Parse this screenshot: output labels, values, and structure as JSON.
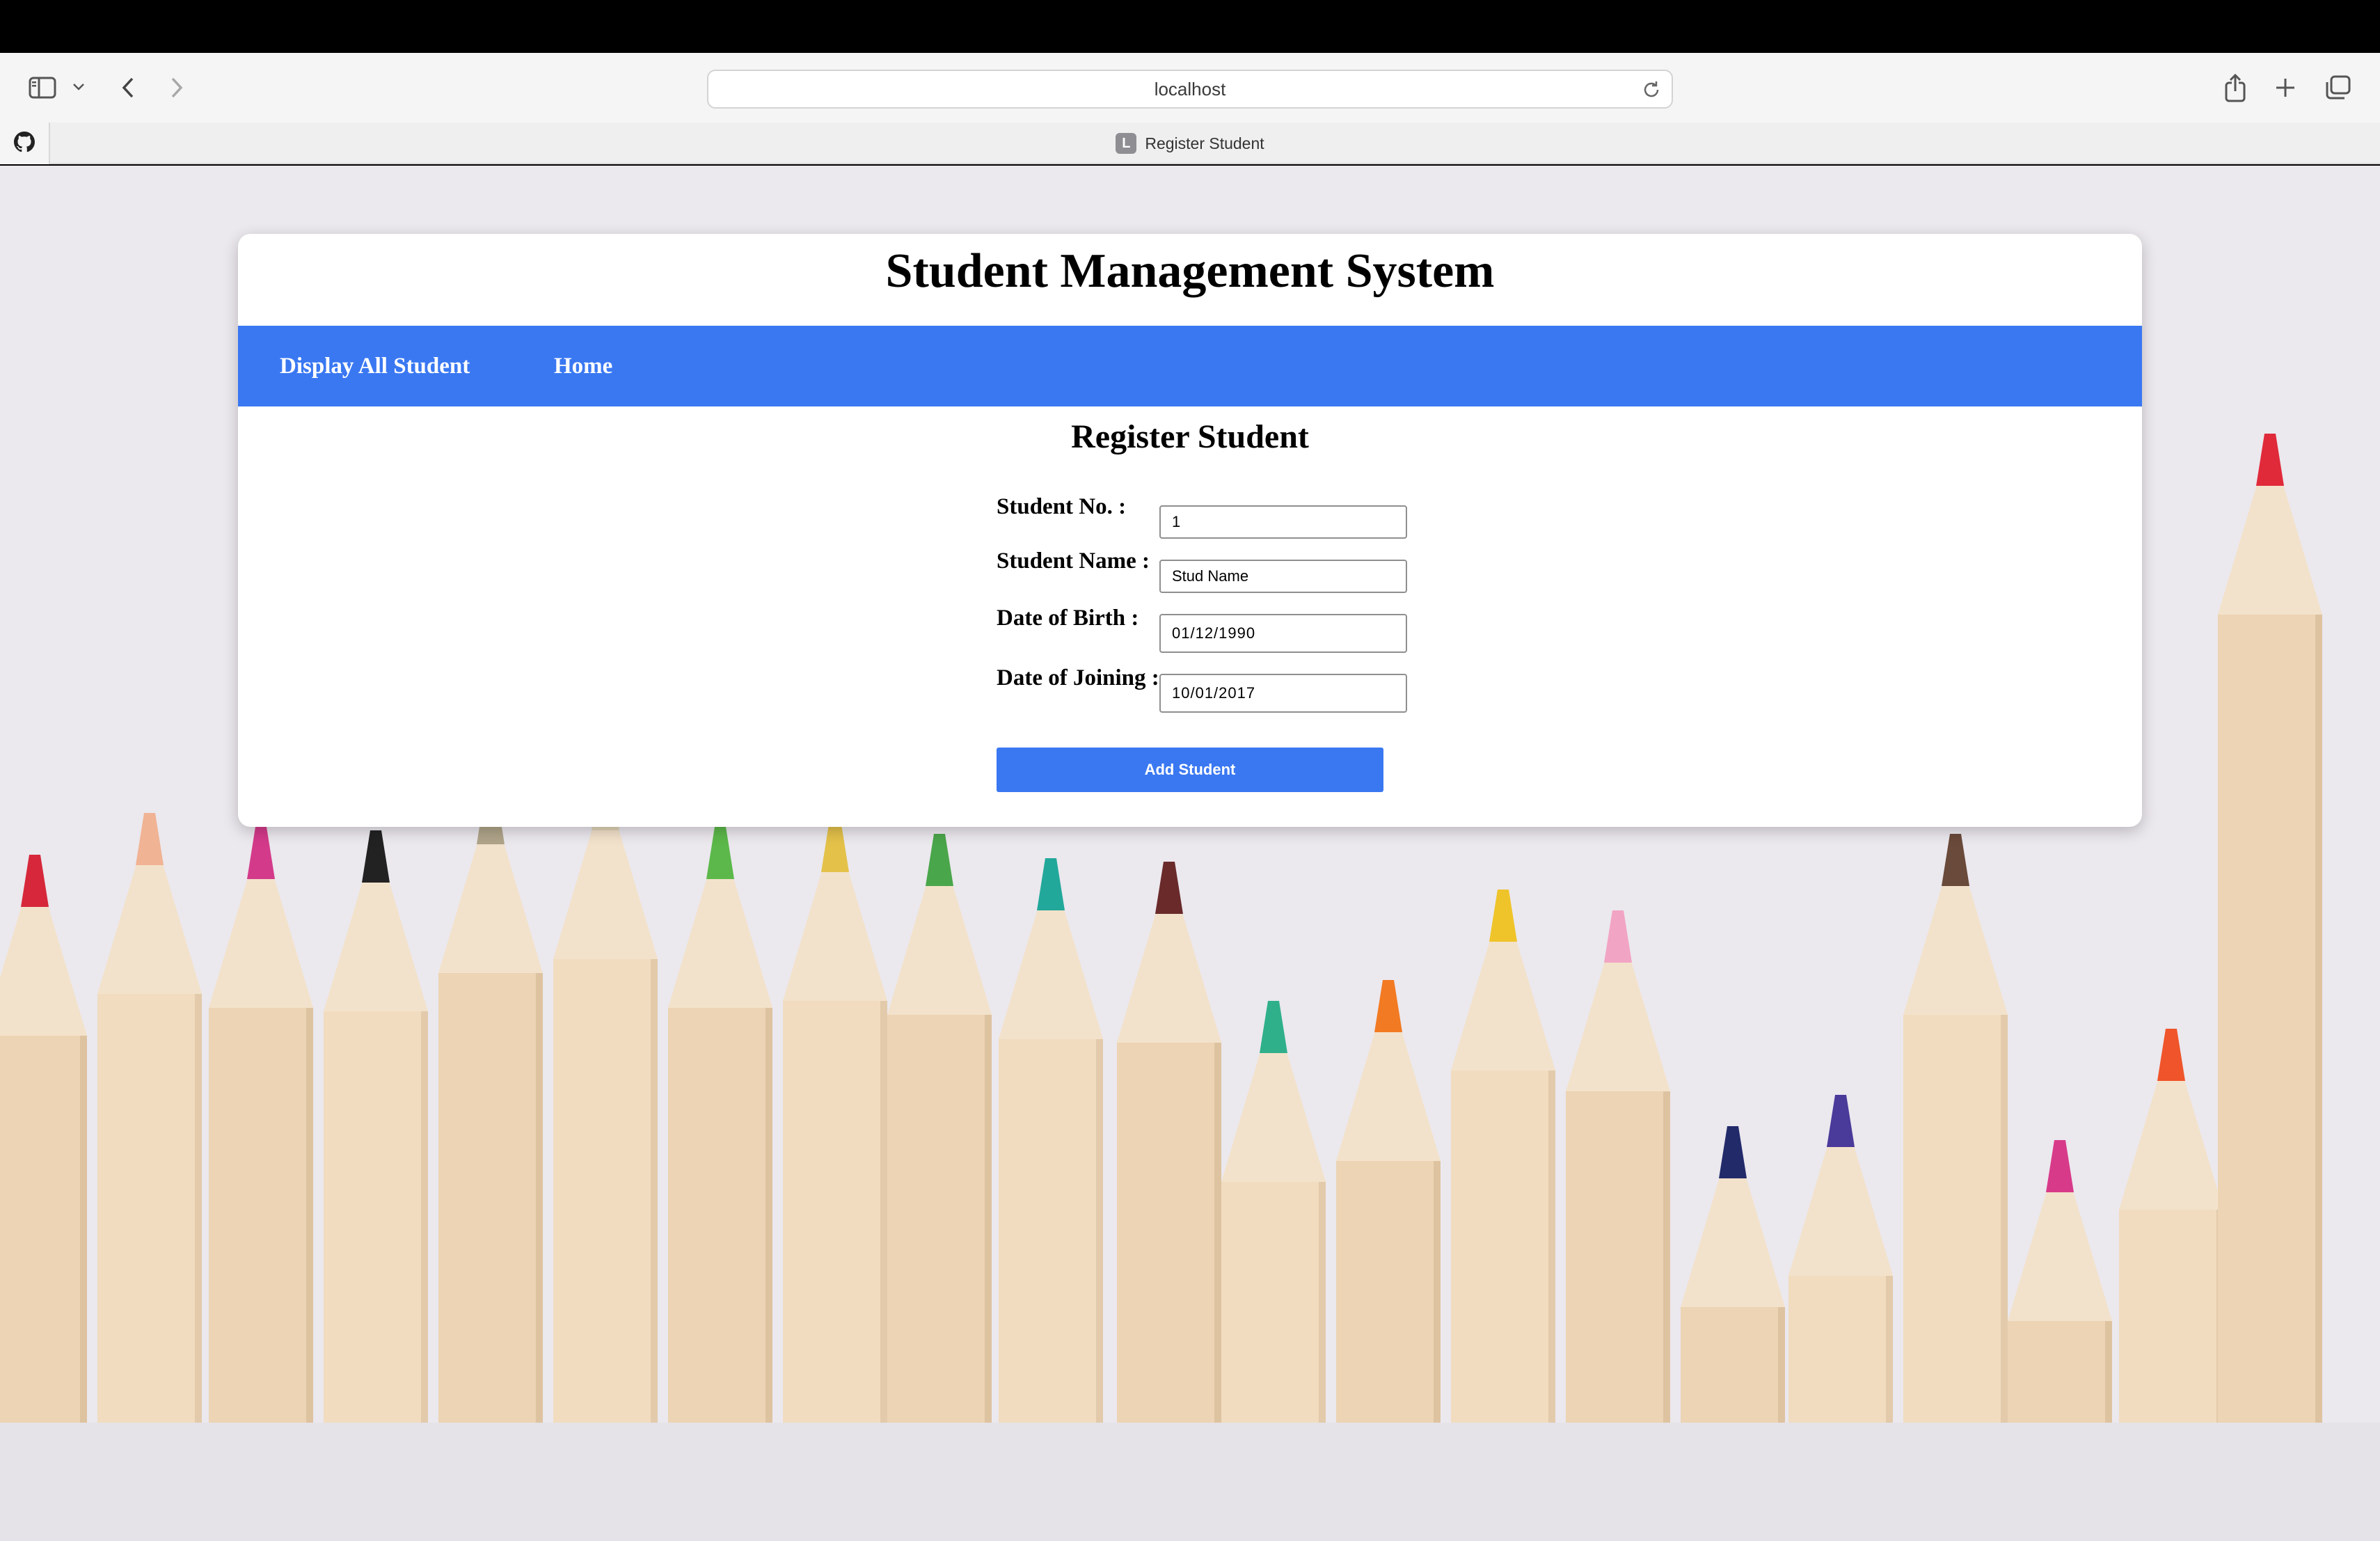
{
  "browser": {
    "url": "localhost",
    "tab": {
      "favicon_letter": "L",
      "title": "Register Student"
    }
  },
  "app": {
    "title": "Student Management System",
    "nav": [
      {
        "label": "Display All Student"
      },
      {
        "label": "Home"
      }
    ]
  },
  "form": {
    "title": "Register Student",
    "fields": [
      {
        "label": "Student No. :",
        "value": "1"
      },
      {
        "label": "Student Name :",
        "value": "Stud Name"
      },
      {
        "label": "Date of Birth :",
        "value": "01/12/1990"
      },
      {
        "label": "Date of Joining :",
        "value": "10/01/2017"
      }
    ],
    "submit_label": "Add Student"
  },
  "colors": {
    "nav_bg": "#3a78f2",
    "button_bg": "#3a78f2"
  },
  "background": {
    "pencil_tips": [
      "#d6283a",
      "#f0b394",
      "#d43a8a",
      "#222222",
      "#b0a58a",
      "#e0d4b8",
      "#5cb84a",
      "#e4c24a",
      "#4aa64a",
      "#22a89a",
      "#6a2a2a",
      "#2fb08a",
      "#f27a22",
      "#efc42a",
      "#f2a4c4",
      "#6a4a3a",
      "#222a6a",
      "#4a3a9a",
      "#d83a8a",
      "#f0542a",
      "#e02a3a"
    ]
  }
}
